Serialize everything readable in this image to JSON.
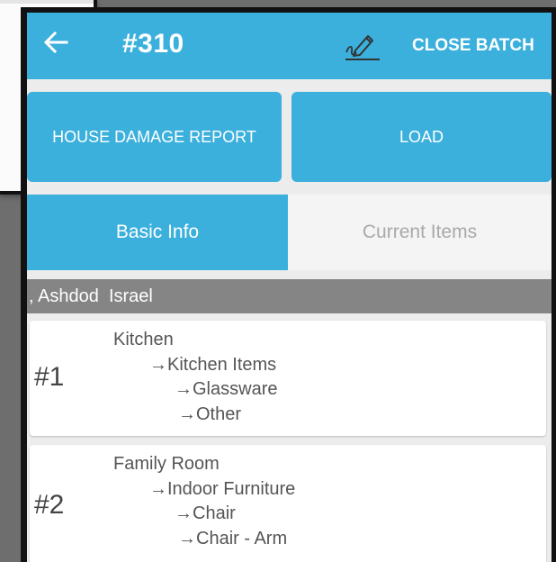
{
  "header": {
    "batch_number": "#310",
    "close_batch_label": "CLOSE BATCH",
    "back_icon": "arrow-left-icon",
    "sign_icon": "signature-pen-icon"
  },
  "actions": {
    "house_damage_report_label": "HOUSE DAMAGE REPORT",
    "load_label": "LOAD"
  },
  "tabs": [
    {
      "label": "Basic Info",
      "active": true
    },
    {
      "label": "Current Items",
      "active": false
    }
  ],
  "address": ", Ashdod  Israel",
  "rooms": [
    {
      "number": "#1",
      "room": "Kitchen",
      "category": "→Kitchen Items",
      "subcategory": "→Glassware",
      "item": "→Other"
    },
    {
      "number": "#2",
      "room": "Family Room",
      "category": "→Indoor Furniture",
      "subcategory": "→Chair",
      "item": "→Chair - Arm"
    }
  ],
  "colors": {
    "accent": "#3bb0dc",
    "address_bar": "#858585",
    "inactive_tab_text": "#a9a9a9"
  }
}
